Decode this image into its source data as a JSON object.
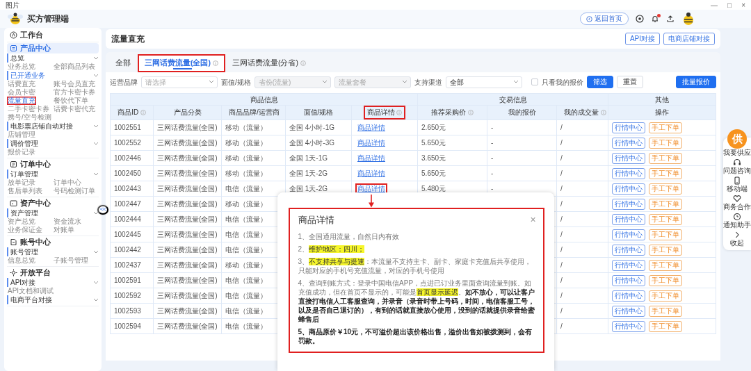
{
  "window": {
    "title": "图片",
    "controls": [
      "—",
      "□",
      "×"
    ]
  },
  "header": {
    "app_name": "买方管理端",
    "home_button": "返回首页",
    "notification_dot": true
  },
  "sidebar": {
    "collapse": "<<",
    "sections": [
      {
        "title": "工作台",
        "selected": false
      },
      {
        "title": "产品中心",
        "selected": true,
        "groups": [
          {
            "title": "总览",
            "active": false,
            "items": [
              {
                "label": "业务总览",
                "selected": false,
                "highlighted": false
              },
              {
                "label": "全部商品列表",
                "selected": false,
                "highlighted": false
              }
            ]
          },
          {
            "title": "已开通业务",
            "active": true,
            "items": [
              {
                "label": "话费直充",
                "selected": false,
                "highlighted": false
              },
              {
                "label": "账号会员直充",
                "selected": false,
                "highlighted": false
              },
              {
                "label": "会员卡密",
                "selected": false,
                "highlighted": false
              },
              {
                "label": "官方卡密卡券",
                "selected": false,
                "highlighted": false
              },
              {
                "label": "流量直充",
                "selected": true,
                "highlighted": true
              },
              {
                "label": "餐饮代下单",
                "selected": false,
                "highlighted": false
              },
              {
                "label": "二手卡密卡券",
                "selected": false,
                "highlighted": false
              },
              {
                "label": "话费卡密代充",
                "selected": false,
                "highlighted": false
              },
              {
                "label": "携号/空号检测",
                "selected": false,
                "highlighted": false
              }
            ]
          },
          {
            "title": "电影票店铺自动对接",
            "active": false,
            "items": [
              {
                "label": "店铺管理",
                "selected": false,
                "highlighted": false
              }
            ]
          },
          {
            "title": "调价管理",
            "active": false,
            "items": [
              {
                "label": "报价记录",
                "selected": false,
                "highlighted": false
              }
            ]
          }
        ]
      },
      {
        "title": "订单中心",
        "selected": false,
        "groups": [
          {
            "title": "订单管理",
            "active": false,
            "items": [
              {
                "label": "放单记录",
                "selected": false,
                "highlighted": false
              },
              {
                "label": "订单中心",
                "selected": false,
                "highlighted": false
              },
              {
                "label": "售后单列表",
                "selected": false,
                "highlighted": false
              },
              {
                "label": "号码检测订单",
                "selected": false,
                "highlighted": false
              }
            ]
          }
        ]
      },
      {
        "title": "资产中心",
        "selected": false,
        "groups": [
          {
            "title": "资产管理",
            "active": false,
            "items": [
              {
                "label": "资产总览",
                "selected": false,
                "highlighted": false
              },
              {
                "label": "资金流水",
                "selected": false,
                "highlighted": false
              },
              {
                "label": "业务保证金",
                "selected": false,
                "highlighted": false
              },
              {
                "label": "对账单",
                "selected": false,
                "highlighted": false
              }
            ]
          }
        ]
      },
      {
        "title": "账号中心",
        "selected": false,
        "groups": [
          {
            "title": "账号管理",
            "active": false,
            "items": [
              {
                "label": "信息总览",
                "selected": false,
                "highlighted": false
              },
              {
                "label": "子账号管理",
                "selected": false,
                "highlighted": false
              }
            ]
          }
        ]
      },
      {
        "title": "开放平台",
        "selected": false,
        "groups": [
          {
            "title": "API对接",
            "active": false,
            "items": [
              {
                "label": "API文档和调试",
                "selected": false,
                "highlighted": false
              }
            ]
          },
          {
            "title": "电商平台对接",
            "active": false
          }
        ]
      }
    ]
  },
  "page": {
    "title": "流量直充",
    "buttons": [
      "API对接",
      "电商店铺对接"
    ]
  },
  "tabs": [
    {
      "label": "全部",
      "selected": false,
      "info": false,
      "highlighted": false
    },
    {
      "label": "三网话费流量(全国)",
      "selected": true,
      "info": true,
      "highlighted": true
    },
    {
      "label": "三网话费流量(分省)",
      "selected": false,
      "info": true,
      "highlighted": false
    }
  ],
  "filters": [
    {
      "kind": "select",
      "label": "运营品牌",
      "placeholder": "请选择",
      "disabled": false
    },
    {
      "kind": "select",
      "label": "面值/规格",
      "placeholder": "省份(流量)",
      "disabled": true
    },
    {
      "kind": "select",
      "placeholder": "流量套餐",
      "disabled": true
    },
    {
      "kind": "select",
      "label": "支持渠道",
      "value": "全部",
      "disabled": false
    },
    {
      "kind": "checkbox",
      "label": "只看我的报价",
      "checked": false
    },
    {
      "kind": "button",
      "label": "筛选",
      "primary": true
    },
    {
      "kind": "button",
      "label": "重置",
      "primary": false
    }
  ],
  "bulk_button": "批量报价",
  "table": {
    "column_groups": [
      {
        "label": "商品信息",
        "columns": [
          {
            "label": "商品ID",
            "info": true,
            "highlighted": false,
            "kind": "text"
          },
          {
            "label": "产品分类",
            "info": false,
            "highlighted": false,
            "kind": "text"
          },
          {
            "label": "商品品牌/运营商",
            "info": false,
            "highlighted": false,
            "kind": "text"
          },
          {
            "label": "面值/规格",
            "info": false,
            "highlighted": false,
            "kind": "text"
          },
          {
            "label": "商品详情",
            "info": true,
            "highlighted": true,
            "kind": "link"
          }
        ]
      },
      {
        "label": "交易信息",
        "columns": [
          {
            "label": "推荐采购价",
            "info": true,
            "highlighted": false,
            "kind": "text"
          },
          {
            "label": "我的报价",
            "info": false,
            "highlighted": false,
            "kind": "text"
          },
          {
            "label": "我的成交量",
            "info": true,
            "highlighted": false,
            "kind": "text"
          }
        ]
      },
      {
        "label": "其他",
        "columns": [
          {
            "label": "操作",
            "info": false,
            "highlighted": false,
            "kind": "actions"
          }
        ]
      }
    ],
    "rows": [
      {
        "cells": [
          "1002551",
          "三网话费流量(全国)",
          "移动（流量）",
          "全国 4小时-1G",
          "商品详情",
          "2.650元",
          "-",
          "/"
        ],
        "actions": [
          "行情中心",
          "手工下单"
        ],
        "highlighted": false
      },
      {
        "cells": [
          "1002552",
          "三网话费流量(全国)",
          "移动（流量）",
          "全国 4小时-3G",
          "商品详情",
          "5.650元",
          "-",
          "/"
        ],
        "actions": [
          "行情中心",
          "手工下单"
        ],
        "highlighted": false
      },
      {
        "cells": [
          "1002446",
          "三网话费流量(全国)",
          "移动（流量）",
          "全国 1天-1G",
          "商品详情",
          "3.650元",
          "-",
          "/"
        ],
        "actions": [
          "行情中心",
          "手工下单"
        ],
        "highlighted": false
      },
      {
        "cells": [
          "1002450",
          "三网话费流量(全国)",
          "移动（流量）",
          "全国 1天-2G",
          "商品详情",
          "5.650元",
          "-",
          "/"
        ],
        "actions": [
          "行情中心",
          "手工下单"
        ],
        "highlighted": false
      },
      {
        "cells": [
          "1002443",
          "三网话费流量(全国)",
          "电信（流量）",
          "全国 1天-2G",
          "商品详情",
          "5.480元",
          "-",
          "/"
        ],
        "actions": [
          "行情中心",
          "手工下单"
        ],
        "highlighted": true
      },
      {
        "cells": [
          "1002447",
          "三网话费流量(全国)",
          "移动（流量）"
        ],
        "end_cells": [
          "/"
        ],
        "actions": [
          "行情中心",
          "手工下单"
        ]
      },
      {
        "cells": [
          "1002444",
          "三网话费流量(全国)",
          "电信（流量）"
        ],
        "end_cells": [
          "/"
        ],
        "actions": [
          "行情中心",
          "手工下单"
        ]
      },
      {
        "cells": [
          "1002445",
          "三网话费流量(全国)",
          "电信（流量）"
        ],
        "end_cells": [
          "/"
        ],
        "actions": [
          "行情中心",
          "手工下单"
        ]
      },
      {
        "cells": [
          "1002442",
          "三网话费流量(全国)",
          "电信（流量）"
        ],
        "end_cells": [
          "/"
        ],
        "actions": [
          "行情中心",
          "手工下单"
        ]
      },
      {
        "cells": [
          "1002437",
          "三网话费流量(全国)",
          "移动（流量）"
        ],
        "end_cells": [
          "/"
        ],
        "actions": [
          "行情中心",
          "手工下单"
        ]
      },
      {
        "cells": [
          "1002591",
          "三网话费流量(全国)",
          "电信（流量）"
        ],
        "end_cells": [
          "/"
        ],
        "actions": [
          "行情中心",
          "手工下单"
        ]
      },
      {
        "cells": [
          "1002592",
          "三网话费流量(全国)",
          "电信（流量）"
        ],
        "end_cells": [
          "/"
        ],
        "actions": [
          "行情中心",
          "手工下单"
        ]
      },
      {
        "cells": [
          "1002593",
          "三网话费流量(全国)",
          "电信（流量）"
        ],
        "end_cells": [
          "/"
        ],
        "actions": [
          "行情中心",
          "手工下单"
        ]
      },
      {
        "cells": [
          "1002594",
          "三网话费流量(全国)",
          "电信（流量）"
        ],
        "end_cells": [
          "/"
        ],
        "actions": [
          "行情中心",
          "手工下单"
        ]
      }
    ]
  },
  "modal": {
    "title": "商品详情",
    "close": "×",
    "highlighted": true,
    "paragraphs": [
      {
        "text": "1、全国通用流量，自然日内有效",
        "bold": false
      },
      {
        "text": "2、*维护地区：四川；*",
        "bold": false
      },
      {
        "text": "3、*不支持共享与提速*：本流量不支持主卡、副卡、家庭卡充值后共享使用，只能对应的手机号充值流量，对应的手机号使用",
        "bold": false
      },
      {
        "segments": [
          {
            "kind": "plain",
            "text": "4、查询到账方式：登录中国电信APP，点进已订业务里面查询流量到账。如充值成功，但在首页不显示的，可能是"
          },
          {
            "kind": "highlight",
            "text": "首页显示延迟"
          },
          {
            "kind": "plain",
            "text": "。"
          },
          {
            "kind": "bold",
            "text": "如不放心，可以让客户直接打电信人工客服查询，并录音（录音时带上号码，时间，电信客服工号，以及是否自己退订的），有到的话就直接放心使用，没到的话就提供录音给蜜蜂售后"
          }
        ],
        "bold": false
      },
      {
        "text": "5、商品原价￥10元，不可溢价超出该价格出售，溢价出售如被拨测到，会有罚款。",
        "bold": true
      }
    ]
  },
  "side_tools": [
    {
      "kind": "featured",
      "glyph": "供",
      "label": "我要供应"
    },
    {
      "kind": "tool",
      "label": "问题咨询"
    },
    {
      "kind": "tool",
      "label": "移动端"
    },
    {
      "kind": "tool",
      "label": "商务合作"
    },
    {
      "kind": "tool",
      "label": "通知助手"
    },
    {
      "kind": "tool",
      "label": "收起"
    }
  ]
}
